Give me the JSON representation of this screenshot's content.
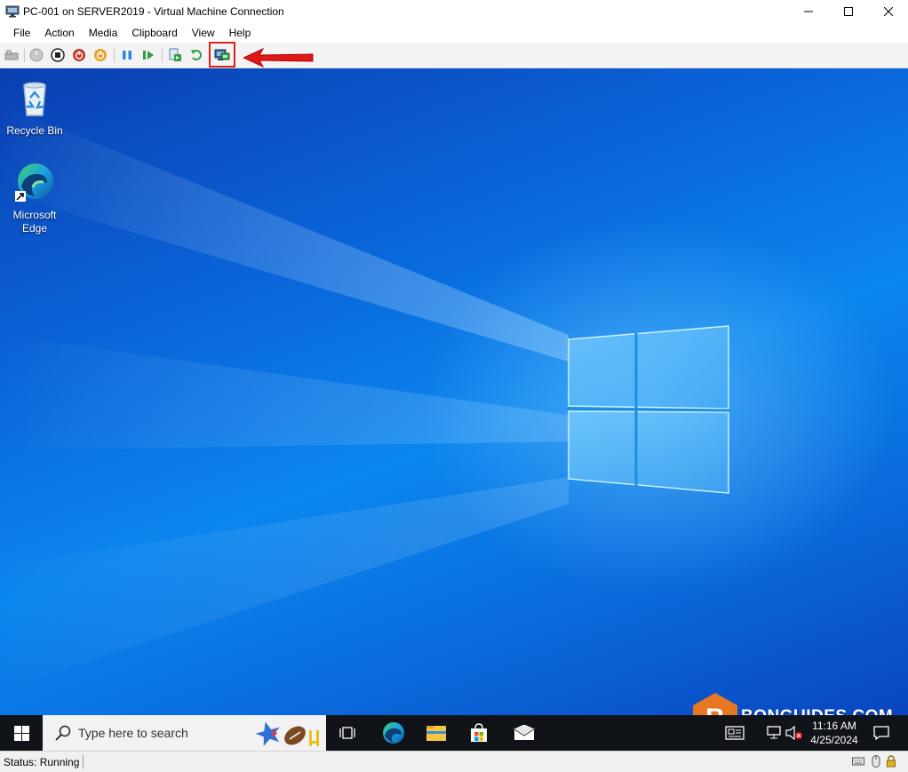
{
  "window": {
    "title": "PC-001 on SERVER2019 - Virtual Machine Connection"
  },
  "menu": [
    "File",
    "Action",
    "Media",
    "Clipboard",
    "View",
    "Help"
  ],
  "toolbar": {
    "buttons": [
      "ctrl-alt-del-icon",
      "start-icon",
      "turn-off-icon",
      "shutdown-icon",
      "save-icon",
      "pause-icon",
      "resume-icon",
      "checkpoint-icon",
      "revert-icon",
      "enhanced-session-icon"
    ],
    "highlight_color": "#e02020"
  },
  "desktop": {
    "icons": [
      {
        "label": "Recycle Bin"
      },
      {
        "label_line1": "Microsoft",
        "label_line2": "Edge"
      }
    ]
  },
  "watermark": {
    "text": "BONGUIDES.COM",
    "letter": "B",
    "color": "#e87722"
  },
  "taskbar": {
    "search_placeholder": "Type here to search",
    "apps": [
      "task-view-icon",
      "edge-icon",
      "file-explorer-icon",
      "store-icon",
      "mail-icon"
    ],
    "time": "11:16 AM",
    "date": "4/25/2024"
  },
  "status": {
    "text": "Status: Running"
  },
  "colors": {
    "accent": "#0078d7",
    "desktop_blue": "#0a63d8",
    "taskbar": "#101317"
  }
}
